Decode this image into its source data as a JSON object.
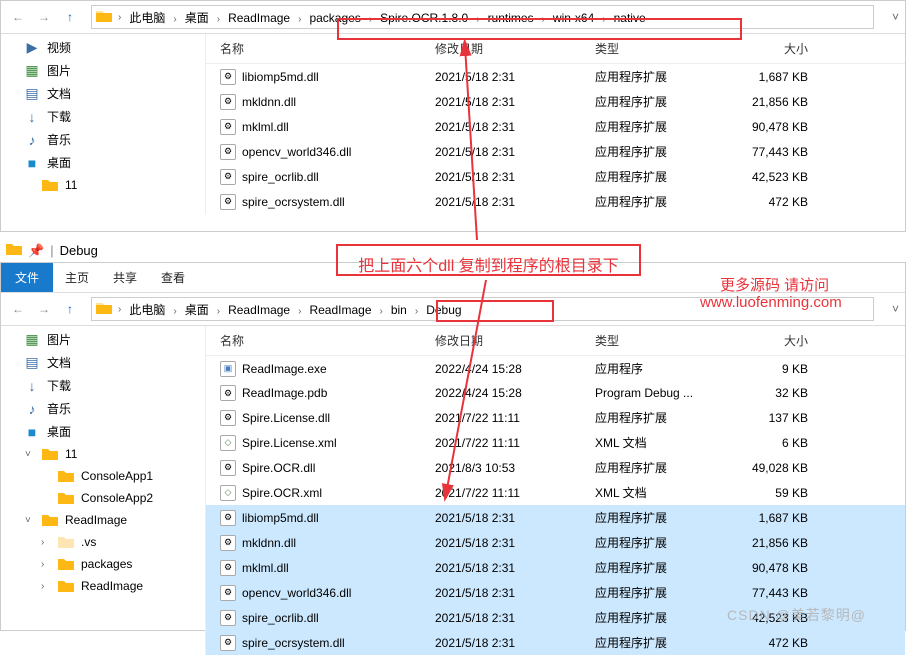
{
  "top": {
    "breadcrumb": [
      "此电脑",
      "桌面",
      "ReadImage",
      "packages",
      "Spire.OCR.1.8.0",
      "runtimes",
      "win-x64",
      "native"
    ],
    "tree": [
      {
        "icon": "video",
        "label": "视频",
        "color": "#3a6ea5"
      },
      {
        "icon": "pictures",
        "label": "图片",
        "color": "#3a8a3a"
      },
      {
        "icon": "docs",
        "label": "文档",
        "color": "#3a6ea5"
      },
      {
        "icon": "downloads",
        "label": "下载",
        "color": "#3a6ea5"
      },
      {
        "icon": "music",
        "label": "音乐",
        "color": "#3a6ea5"
      },
      {
        "icon": "desktop",
        "label": "桌面",
        "color": "#1a8acb"
      },
      {
        "icon": "folder",
        "label": "11",
        "color": "#fdb813",
        "indent": true
      }
    ],
    "cols": {
      "name": "名称",
      "date": "修改日期",
      "type": "类型",
      "size": "大小"
    },
    "files": [
      {
        "name": "libiomp5md.dll",
        "date": "2021/5/18 2:31",
        "type": "应用程序扩展",
        "size": "1,687 KB"
      },
      {
        "name": "mkldnn.dll",
        "date": "2021/5/18 2:31",
        "type": "应用程序扩展",
        "size": "21,856 KB"
      },
      {
        "name": "mklml.dll",
        "date": "2021/5/18 2:31",
        "type": "应用程序扩展",
        "size": "90,478 KB"
      },
      {
        "name": "opencv_world346.dll",
        "date": "2021/5/18 2:31",
        "type": "应用程序扩展",
        "size": "77,443 KB"
      },
      {
        "name": "spire_ocrlib.dll",
        "date": "2021/5/18 2:31",
        "type": "应用程序扩展",
        "size": "42,523 KB"
      },
      {
        "name": "spire_ocrsystem.dll",
        "date": "2021/5/18 2:31",
        "type": "应用程序扩展",
        "size": "472 KB"
      }
    ]
  },
  "bottom": {
    "title": "Debug",
    "tabs": {
      "file": "文件",
      "home": "主页",
      "share": "共享",
      "view": "查看"
    },
    "breadcrumb": [
      "此电脑",
      "桌面",
      "ReadImage",
      "ReadImage",
      "bin",
      "Debug"
    ],
    "tree": [
      {
        "icon": "pictures",
        "label": "图片",
        "color": "#3a8a3a",
        "indent": 0
      },
      {
        "icon": "docs",
        "label": "文档",
        "color": "#3a6ea5",
        "indent": 0
      },
      {
        "icon": "downloads",
        "label": "下载",
        "color": "#3a6ea5",
        "indent": 0
      },
      {
        "icon": "music",
        "label": "音乐",
        "color": "#3a6ea5",
        "indent": 0
      },
      {
        "icon": "desktop",
        "label": "桌面",
        "color": "#1a8acb",
        "indent": 0
      },
      {
        "icon": "folder",
        "label": "11",
        "indent": 1,
        "exp": true
      },
      {
        "icon": "folder",
        "label": "ConsoleApp1",
        "indent": 2
      },
      {
        "icon": "folder",
        "label": "ConsoleApp2",
        "indent": 2
      },
      {
        "icon": "folder",
        "label": "ReadImage",
        "indent": 1,
        "exp": true
      },
      {
        "icon": "folder-hidden",
        "label": ".vs",
        "indent": 2,
        "exp": false
      },
      {
        "icon": "folder",
        "label": "packages",
        "indent": 2,
        "exp": false
      },
      {
        "icon": "folder",
        "label": "ReadImage",
        "indent": 2,
        "exp": false
      }
    ],
    "cols": {
      "name": "名称",
      "date": "修改日期",
      "type": "类型",
      "size": "大小"
    },
    "files": [
      {
        "name": "ReadImage.exe",
        "date": "2022/4/24 15:28",
        "type": "应用程序",
        "size": "9 KB",
        "ico": "exe"
      },
      {
        "name": "ReadImage.pdb",
        "date": "2022/4/24 15:28",
        "type": "Program Debug ...",
        "size": "32 KB",
        "ico": "pdb"
      },
      {
        "name": "Spire.License.dll",
        "date": "2021/7/22 11:11",
        "type": "应用程序扩展",
        "size": "137 KB",
        "ico": "dll"
      },
      {
        "name": "Spire.License.xml",
        "date": "2021/7/22 11:11",
        "type": "XML 文档",
        "size": "6 KB",
        "ico": "xml"
      },
      {
        "name": "Spire.OCR.dll",
        "date": "2021/8/3 10:53",
        "type": "应用程序扩展",
        "size": "49,028 KB",
        "ico": "dll"
      },
      {
        "name": "Spire.OCR.xml",
        "date": "2021/7/22 11:11",
        "type": "XML 文档",
        "size": "59 KB",
        "ico": "xml"
      },
      {
        "name": "libiomp5md.dll",
        "date": "2021/5/18 2:31",
        "type": "应用程序扩展",
        "size": "1,687 KB",
        "ico": "dll",
        "sel": true
      },
      {
        "name": "mkldnn.dll",
        "date": "2021/5/18 2:31",
        "type": "应用程序扩展",
        "size": "21,856 KB",
        "ico": "dll",
        "sel": true
      },
      {
        "name": "mklml.dll",
        "date": "2021/5/18 2:31",
        "type": "应用程序扩展",
        "size": "90,478 KB",
        "ico": "dll",
        "sel": true
      },
      {
        "name": "opencv_world346.dll",
        "date": "2021/5/18 2:31",
        "type": "应用程序扩展",
        "size": "77,443 KB",
        "ico": "dll",
        "sel": true
      },
      {
        "name": "spire_ocrlib.dll",
        "date": "2021/5/18 2:31",
        "type": "应用程序扩展",
        "size": "42,523 KB",
        "ico": "dll",
        "sel": true
      },
      {
        "name": "spire_ocrsystem.dll",
        "date": "2021/5/18 2:31",
        "type": "应用程序扩展",
        "size": "472 KB",
        "ico": "dll",
        "sel": true
      }
    ]
  },
  "annotations": {
    "instruction": "把上面六个dll 复制到程序的根目录下",
    "link1": "更多源码 请访问",
    "link2": "www.luofenming.com",
    "watermark": "CSDN @美若黎明@"
  }
}
